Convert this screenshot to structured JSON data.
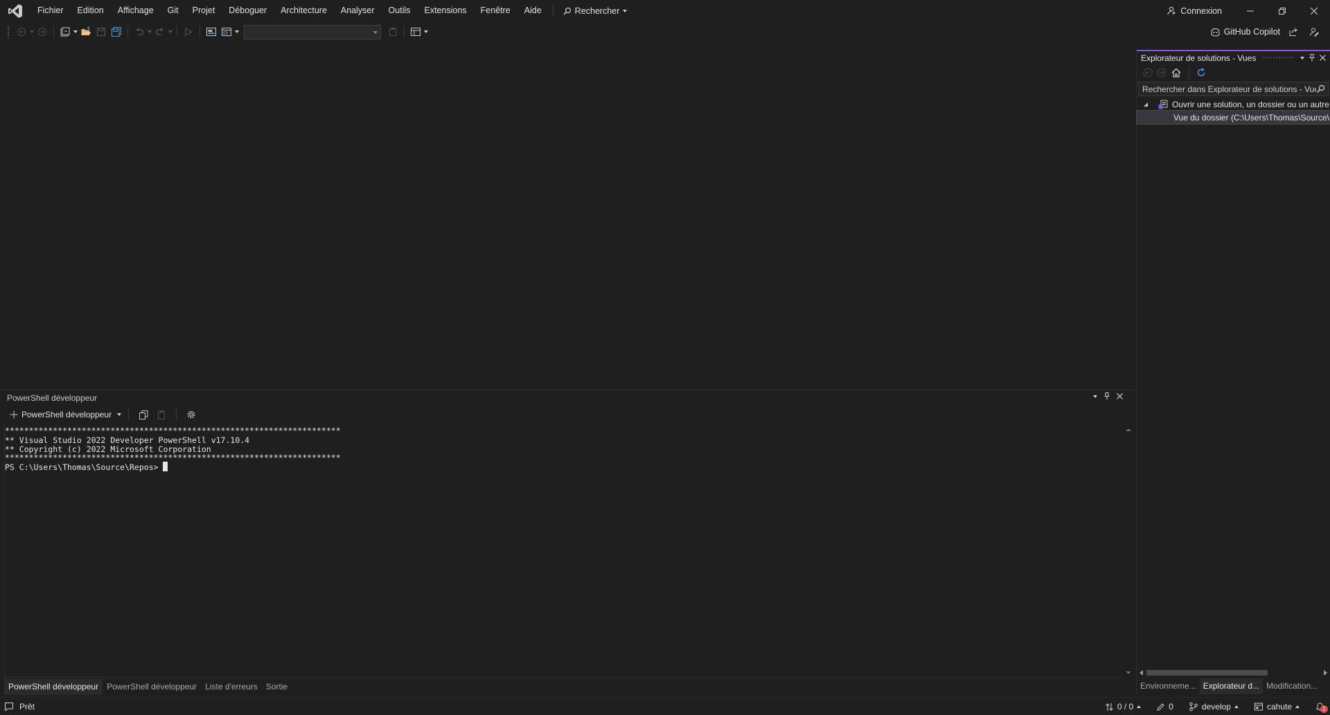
{
  "menu": {
    "items": [
      "Fichier",
      "Edition",
      "Affichage",
      "Git",
      "Projet",
      "Déboguer",
      "Architecture",
      "Analyser",
      "Outils",
      "Extensions",
      "Fenêtre",
      "Aide"
    ],
    "search_label": "Rechercher"
  },
  "titlebar": {
    "connexion_label": "Connexion"
  },
  "toolbar": {
    "copilot_label": "GitHub Copilot",
    "config_combo_value": ""
  },
  "solution_explorer": {
    "title": "Explorateur de solutions - Vues",
    "search_placeholder": "Rechercher dans Explorateur de solutions - Vues",
    "tree": [
      {
        "label": "Ouvrir une solution, un dossier ou un autre",
        "icon": "solution-icon",
        "expanded": true
      },
      {
        "label": "Vue du dossier (C:\\Users\\Thomas\\Source\\Repos)",
        "icon": "folder-icon",
        "selected": true
      }
    ],
    "tabs": [
      "Environneme...",
      "Explorateur d...",
      "Modification..."
    ],
    "active_tab": 1
  },
  "powershell": {
    "title": "PowerShell développeur",
    "profile_label": "PowerShell développeur",
    "lines": [
      "**********************************************************************",
      "** Visual Studio 2022 Developer PowerShell v17.10.4",
      "** Copyright (c) 2022 Microsoft Corporation",
      "**********************************************************************",
      "PS C:\\Users\\Thomas\\Source\\Repos> "
    ],
    "tabs": [
      "PowerShell développeur",
      "PowerShell développeur",
      "Liste d'erreurs",
      "Sortie"
    ],
    "active_tab": 0
  },
  "status": {
    "ready": "Prêt",
    "changes": "0 / 0",
    "edits": "0",
    "branch": "develop",
    "repo": "cahute",
    "notification_count": "1"
  },
  "colors": {
    "accent": "#7f5cd6",
    "background": "#1f1f1f",
    "text": "#e0e0e0",
    "notification": "#e24c4c"
  }
}
